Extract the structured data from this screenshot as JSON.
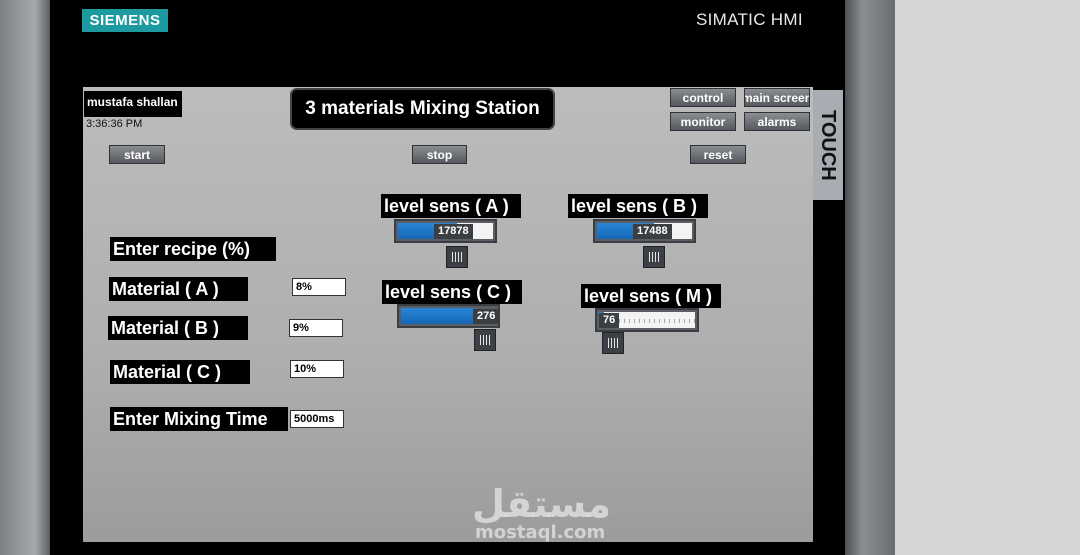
{
  "device": {
    "brand": "SIEMENS",
    "model": "SIMATIC HMI",
    "side_label": "TOUCH"
  },
  "header": {
    "user": "mustafa shallan",
    "time": "3:36:36 PM",
    "title": "3 materials Mixing Station"
  },
  "nav": {
    "control": "control",
    "main_screen": "main screen",
    "monitor": "monitor",
    "alarms": "alarms"
  },
  "actions": {
    "start": "start",
    "stop": "stop",
    "reset": "reset"
  },
  "recipe": {
    "heading": "Enter recipe (%)",
    "material_a_label": "Material ( A )",
    "material_a_value": "8%",
    "material_b_label": "Material ( B )",
    "material_b_value": "9%",
    "material_c_label": "Material ( C )",
    "material_c_value": "10%",
    "mix_time_label": "Enter Mixing Time",
    "mix_time_value": "5000ms"
  },
  "sensors": {
    "a": {
      "label": "level sens ( A )",
      "value": "17878",
      "fill_fraction": 0.62
    },
    "b": {
      "label": "level sens ( B )",
      "value": "17488",
      "fill_fraction": 0.6
    },
    "c": {
      "label": "level sens ( C )",
      "value": "276",
      "fill_fraction": 0.78
    },
    "m": {
      "label": "level sens ( M )",
      "value": "76",
      "fill_fraction": 0.05
    }
  },
  "watermark": {
    "brand": "مستقل",
    "site": "mostaql.com"
  },
  "colors": {
    "bezel": "#000000",
    "screen": "#b3b3b3",
    "brand_logo": "#1d9aa0",
    "bar_fill": "#1f74c6",
    "button": "#6d7074"
  }
}
